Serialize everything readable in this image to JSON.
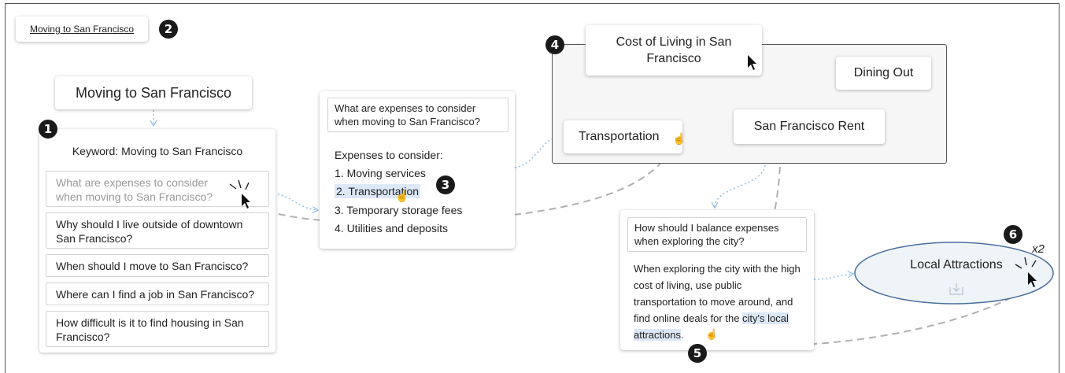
{
  "breadcrumb": {
    "label": "Moving to San Francisco"
  },
  "badges": [
    "1",
    "2",
    "3",
    "4",
    "5",
    "6"
  ],
  "root_node": {
    "label": "Moving to San Francisco"
  },
  "keyword_panel": {
    "title": "Keyword: Moving to San Francisco",
    "questions": [
      "What are expenses to consider when moving to San Francisco?",
      "Why should I live outside of downtown San Francisco?",
      "When should I move to San Francisco?",
      "Where can I find a job in San Francisco?",
      "How difficult is it to find housing in San Francisco?"
    ]
  },
  "answer_panel": {
    "question": "What are expenses to consider when moving to San Francisco?",
    "intro": "Expenses to consider:",
    "items": [
      "1. Moving services",
      "2. Transportation",
      "3. Temporary storage fees",
      "4. Utilities and deposits"
    ]
  },
  "group_box": {
    "nodes": {
      "cost_of_living": "Cost of Living in San Francisco",
      "dining_out": "Dining Out",
      "transportation": "Transportation",
      "rent": "San Francisco Rent"
    }
  },
  "balance_panel": {
    "question": "How should I balance expenses when exploring the city?",
    "answer_before": "When exploring the city with the high cost of living, use public transportation to move around, and find online deals for the ",
    "answer_highlight": "city's local attractions",
    "answer_after": "."
  },
  "attractions_node": {
    "label": "Local Attractions",
    "click_count": "x2"
  },
  "colors": {
    "highlight": "#dce8f7",
    "ellipse_fill": "#eef4f7",
    "ellipse_stroke": "#4a6fa0",
    "arrow_blue": "#8cbde8",
    "path_gray": "#b0b0b0"
  }
}
